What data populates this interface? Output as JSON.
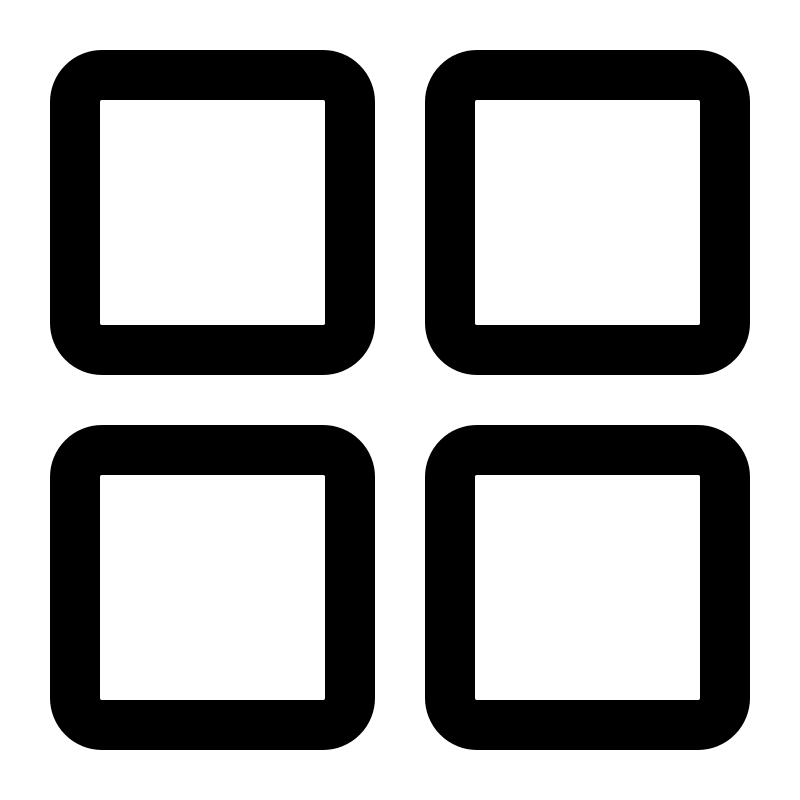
{
  "icon": {
    "name": "grid-icon",
    "color": "#000000",
    "background": "#ffffff"
  }
}
